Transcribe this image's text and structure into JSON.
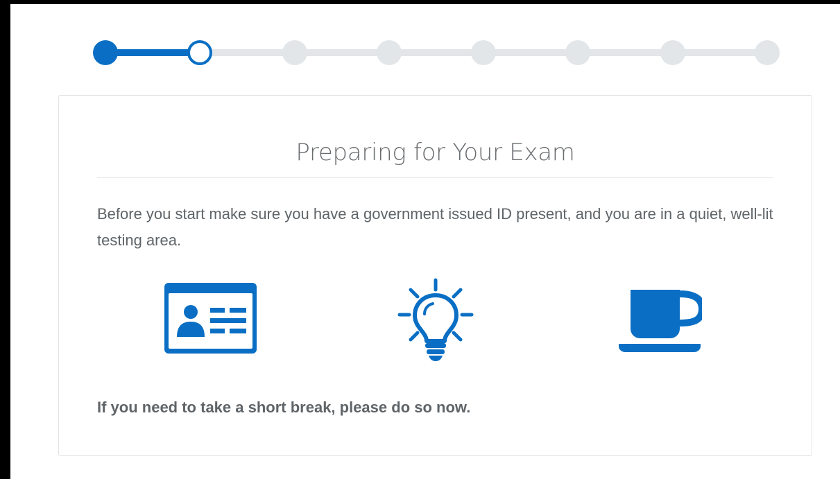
{
  "progress": {
    "total_steps": 8,
    "completed_steps": 1,
    "current_step": 2
  },
  "card": {
    "title": "Preparing for Your Exam",
    "intro": "Before you start make sure you have a government issued ID present, and you are in a quiet, well-lit testing area.",
    "icons": [
      "id-card-icon",
      "lightbulb-icon",
      "coffee-cup-icon"
    ],
    "note": "If you need to take a short break, please do so now."
  },
  "colors": {
    "accent": "#0a6fc4",
    "inactive": "#e2e6e9",
    "text": "#5f6468"
  }
}
